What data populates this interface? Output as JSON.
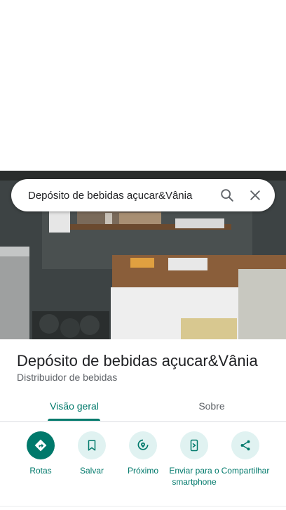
{
  "search": {
    "query": "Depósito de bebidas açucar&Vânia"
  },
  "place": {
    "name": "Depósito de bebidas açucar&Vânia",
    "category": "Distribuidor de bebidas"
  },
  "tabs": [
    {
      "label": "Visão geral",
      "active": true
    },
    {
      "label": "Sobre",
      "active": false
    }
  ],
  "actions": [
    {
      "label": "Rotas",
      "icon": "directions-icon"
    },
    {
      "label": "Salvar",
      "icon": "bookmark-icon"
    },
    {
      "label": "Próximo",
      "icon": "nearby-icon"
    },
    {
      "label": "Enviar para o smartphone",
      "icon": "send-to-phone-icon"
    },
    {
      "label": "Compartilhar",
      "icon": "share-icon"
    }
  ],
  "colors": {
    "accent": "#00796b",
    "accent_light": "#e0f2f1"
  }
}
